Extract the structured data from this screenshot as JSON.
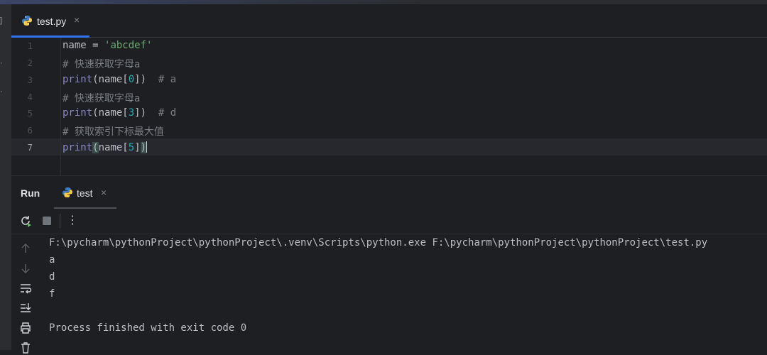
{
  "editor": {
    "tab": {
      "filename": "test.py",
      "close": "×"
    },
    "line_numbers": [
      "1",
      "2",
      "3",
      "4",
      "5",
      "6",
      "7"
    ],
    "lines": [
      {
        "a": "name = ",
        "b": "'abcdef'"
      },
      {
        "comment": "# 快速获取字母a"
      },
      {
        "fn": "print",
        "a": "(name[",
        "num": "0",
        "b": "])  ",
        "comment": "# a"
      },
      {
        "comment": "# 快速获取字母a"
      },
      {
        "fn": "print",
        "a": "(name[",
        "num": "3",
        "b": "])  ",
        "comment": "# d"
      },
      {
        "comment": "# 获取索引下标最大值"
      },
      {
        "fn": "print",
        "open": "(",
        "a": "name[",
        "num": "5",
        "b": "]",
        "close": ")"
      }
    ]
  },
  "run_panel": {
    "title": "Run",
    "tab_label": "test",
    "tab_close": "×",
    "toolbar": {
      "rerun_icon": "rerun-icon",
      "stop_icon": "stop-icon",
      "more_icon": "more-vertical-icon",
      "more_label": "⋮"
    },
    "sidebar_icons": [
      "arrow-up-icon",
      "arrow-down-icon",
      "soft-wrap-icon",
      "scroll-to-end-icon",
      "print-icon",
      "trash-icon"
    ],
    "console": [
      "F:\\pycharm\\pythonProject\\pythonProject\\.venv\\Scripts\\python.exe F:\\pycharm\\pythonProject\\pythonProject\\test.py",
      "a",
      "d",
      "f",
      "",
      "Process finished with exit code 0"
    ]
  },
  "colors": {
    "background": "#1e1f22",
    "accent": "#3574f0",
    "string": "#6aab73",
    "comment": "#7a7e85",
    "builtin": "#8888c6",
    "number": "#2aacb8"
  }
}
